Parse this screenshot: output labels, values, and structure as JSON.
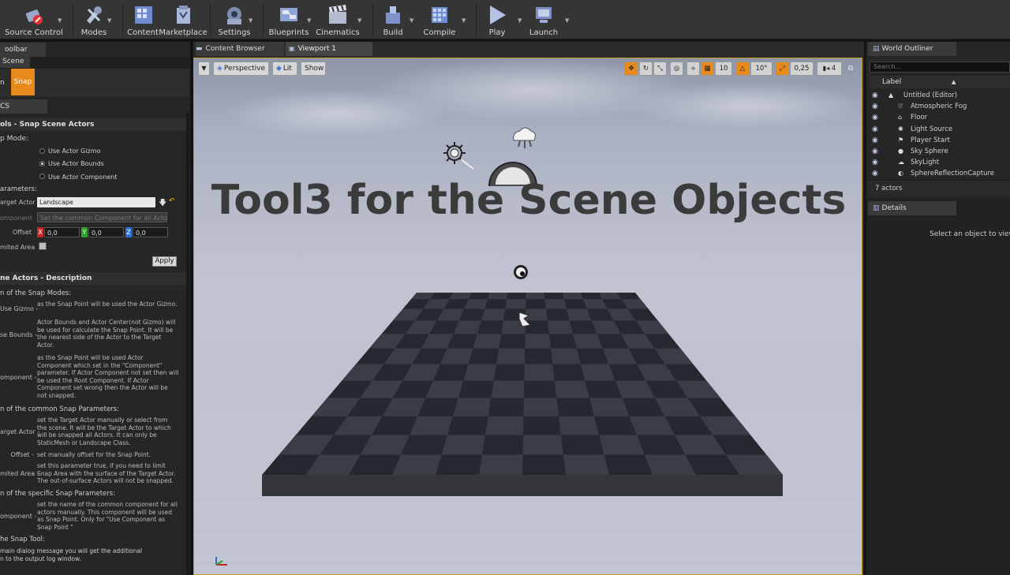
{
  "toolbar": {
    "items": [
      {
        "label": "Source Control",
        "icon": "source-control-icon"
      },
      {
        "label": "Modes",
        "icon": "modes-icon"
      },
      {
        "label": "Content",
        "icon": "content-icon"
      },
      {
        "label": "Marketplace",
        "icon": "marketplace-icon"
      },
      {
        "label": "Settings",
        "icon": "settings-icon"
      },
      {
        "label": "Blueprints",
        "icon": "blueprints-icon"
      },
      {
        "label": "Cinematics",
        "icon": "cinematics-icon"
      },
      {
        "label": "Build",
        "icon": "build-icon"
      },
      {
        "label": "Compile",
        "icon": "compile-icon"
      },
      {
        "label": "Play",
        "icon": "play-icon"
      },
      {
        "label": "Launch",
        "icon": "launch-icon"
      }
    ]
  },
  "left_panel": {
    "tab_toolbar": "oolbar",
    "tab_scene": "Scene",
    "btn_prev": "n",
    "btn_snap": "Snap",
    "tab_cs": "CS",
    "section_title": "ols - Snap Scene Actors",
    "snap_mode_label": "p Mode:",
    "modes": [
      "Use Actor Gizmo",
      "Use Actor Bounds",
      "Use Actor Component"
    ],
    "selected_mode": "Use Actor Bounds",
    "params_label": "arameters:",
    "target_actor_label": "arget Actor",
    "target_actor_value": "Landscape",
    "component_label": "omponent",
    "component_placeholder": "Set the common Component for all Actors",
    "offset_label": "Offset",
    "offset_x": "0,0",
    "offset_y": "0,0",
    "offset_z": "0,0",
    "axis_x": "X",
    "axis_y": "Y",
    "axis_z": "Z",
    "limited_area_label": "mited Area",
    "apply_label": "Apply",
    "desc_title": "ne Actors - Description",
    "modes_heading": "n of the Snap Modes:",
    "desc_modes": [
      {
        "label": "Use Gizmo -",
        "text": "as the Snap Point will be used the Actor Gizmo."
      },
      {
        "label": "se Bounds -",
        "text": "Actor Bounds and Actor Center(not Gizmo) will be used for calculate the Snap Point. It will be the nearest side of the Actor to the Target Actor."
      },
      {
        "label": "omponent -",
        "text": "as the Snap Point will be used Actor Component which set in the \"Component\" parameter. If Actor Component not set then will be used the Root Component. If Actor Component set wrong then the Actor will be not snapped."
      }
    ],
    "common_heading": "n of the common Snap Parameters:",
    "desc_common": [
      {
        "label": "arget Actor -",
        "text": "set the Target Actor manually or select from the scene. It will be the Target Actor to which will be snapped all Actors. It can only be StaticMesh or Landscape Class."
      },
      {
        "label": "Offset -",
        "text": "set manually offset for the Snap Point."
      },
      {
        "label": "mited Area -",
        "text": "set this parameter true, if you need to limit Snap Area with the surface of the Target Actor. The out-of-surface Actors will not be snapped."
      }
    ],
    "specific_heading": "n of the specific Snap Parameters:",
    "desc_specific": [
      {
        "label": "omponent -",
        "text": "set the name of the common component for all actors manually. This component will be used as Snap Point. Only for \"Use Component as Snap Point \""
      }
    ],
    "tool_heading": "he Snap Tool:",
    "tool_text_1": "main dialog message you will get the additional",
    "tool_text_2": "n to the output log window."
  },
  "tabs": {
    "content_browser": "Content Browser",
    "viewport": "Viewport 1"
  },
  "viewport": {
    "perspective": "Perspective",
    "lit": "Lit",
    "show": "Show",
    "grid_snap": "10",
    "rot_snap": "10°",
    "scale_snap": "0,25",
    "cam_speed": "4",
    "overlay_title": "Tool3 for the Scene Objects"
  },
  "outliner": {
    "tab": "World Outliner",
    "search_placeholder": "Search...",
    "col_label": "Label",
    "items": [
      "Untitled (Editor)",
      "Atmospheric Fog",
      "Floor",
      "Light Source",
      "Player Start",
      "Sky Sphere",
      "SkyLight",
      "SphereReflectionCapture"
    ],
    "count": "7 actors"
  },
  "details": {
    "tab": "Details",
    "empty_msg": "Select an object to view d"
  },
  "colors": {
    "accent": "#e8891c",
    "viewport_border": "#c59b2a",
    "axis_x": "#c62828",
    "axis_y": "#2e9e2e",
    "axis_z": "#2f6fd6"
  }
}
